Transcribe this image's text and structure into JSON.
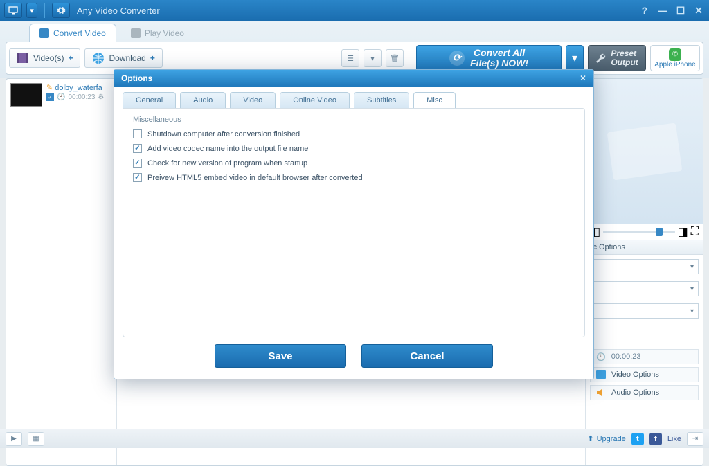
{
  "app": {
    "title": "Any Video Converter"
  },
  "window": {
    "help": "?",
    "min": "—",
    "max": "☐",
    "close": "✕"
  },
  "main_tabs": {
    "convert": "Convert Video",
    "play": "Play Video"
  },
  "actions": {
    "videos": "Video(s)",
    "download": "Download",
    "convert_all_l1": "Convert All",
    "convert_all_l2": "File(s) NOW!",
    "preset_l1": "Preset",
    "preset_l2": "Output",
    "device": "Apple iPhone"
  },
  "list": {
    "items": [
      {
        "name": "dolby_waterfa",
        "duration": "00:00:23"
      }
    ]
  },
  "right": {
    "basic_options": "ic Options",
    "duration": "00:00:23",
    "video_options": "Video Options",
    "audio_options": "Audio Options"
  },
  "status": {
    "upgrade": "Upgrade",
    "like": "Like"
  },
  "modal": {
    "title": "Options",
    "tabs": {
      "general": "General",
      "audio": "Audio",
      "video": "Video",
      "online": "Online Video",
      "subtitles": "Subtitles",
      "misc": "Misc"
    },
    "section": "Miscellaneous",
    "checks": [
      {
        "checked": false,
        "label": "Shutdown computer after conversion finished"
      },
      {
        "checked": true,
        "label": "Add video codec name into the output file name"
      },
      {
        "checked": true,
        "label": "Check for new version of program when startup"
      },
      {
        "checked": true,
        "label": "Preivew HTML5 embed video in default browser after converted"
      }
    ],
    "save": "Save",
    "cancel": "Cancel"
  }
}
